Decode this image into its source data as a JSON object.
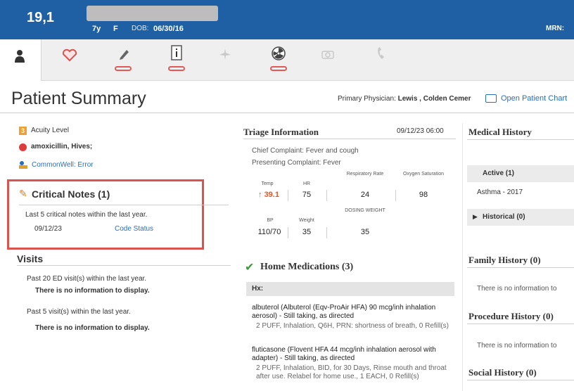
{
  "header": {
    "room": "19,1",
    "age": "7y",
    "sex": "F",
    "dob_label": "DOB:",
    "dob_value": "06/30/16",
    "mrn_label": "MRN:"
  },
  "toolbar": {
    "icons": [
      "person-icon",
      "heart-icon",
      "pen-icon",
      "info-icon",
      "plane-icon",
      "radiation-icon",
      "camera-icon",
      "phone-icon"
    ]
  },
  "page": {
    "title": "Patient Summary",
    "physician_label": "Primary Physician:",
    "physician_name": "Lewis , Colden Cemer",
    "open_chart": "Open Patient Chart"
  },
  "left": {
    "acuity_badge": "3",
    "acuity_label": "Acuity Level",
    "allergy": "amoxicillin, Hives;",
    "commonwell": "CommonWell: Error",
    "critical_notes": {
      "title": "Critical Notes (1)",
      "desc": "Last 5 critical notes within the last year.",
      "date": "09/12/23",
      "link": "Code Status"
    },
    "visits": {
      "title": "Visits",
      "line1": "Past 20 ED visit(s) within the last year.",
      "none1": "There is no information to display.",
      "line2": "Past 5 visit(s) within the last year.",
      "none2": "There is no information to display."
    }
  },
  "triage": {
    "title": "Triage Information",
    "timestamp": "09/12/23 06:00",
    "chief": "Chief Complaint: Fever and cough",
    "presenting": "Presenting Complaint: Fever",
    "vitals_row1": [
      {
        "label": "Temp",
        "value": "39.1",
        "flag": "↑"
      },
      {
        "label": "HR",
        "value": "75"
      },
      {
        "label": "Respiratory Rate",
        "value": "24"
      },
      {
        "label": "Oxygen Saturation",
        "value": "98"
      }
    ],
    "vitals_row2": [
      {
        "label": "BP",
        "value": "110/70"
      },
      {
        "label": "Weight",
        "value": "35"
      },
      {
        "label": "DOSING WEIGHT",
        "value": "35"
      }
    ]
  },
  "meds": {
    "title": "Home Medications (3)",
    "hx": "Hx:",
    "items": [
      {
        "name": "albuterol (Albuterol (Eqv-ProAir HFA) 90 mcg/inh inhalation aerosol) - Still taking, as directed",
        "detail": "2 PUFF, Inhalation, Q6H, PRN: shortness of breath, 0 Refill(s)"
      },
      {
        "name": "fluticasone (Flovent HFA 44 mcg/inh inhalation aerosol with adapter) - Still taking, as directed",
        "detail": "2 PUFF, Inhalation, BID, for 30 Days, Rinse mouth and throat after use. Relabel for home use., 1 EACH, 0 Refill(s)"
      }
    ]
  },
  "right": {
    "medical_history": "Medical History",
    "active": "Active (1)",
    "asthma": "Asthma - 2017",
    "historical": "Historical (0)",
    "family_history": "Family History (0)",
    "family_none": "There is no information to",
    "procedure_history": "Procedure History (0)",
    "procedure_none": "There is no information to",
    "social_history": "Social History (0)"
  }
}
